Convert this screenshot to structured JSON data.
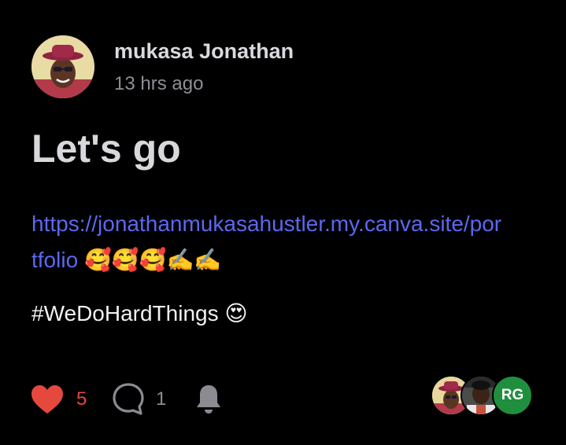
{
  "post": {
    "author_name": "mukasa Jonathan",
    "timestamp": "13 hrs ago",
    "title": "Let's go",
    "link_text": "https://jonathanmukasahustler.my.canva.site/portfolio",
    "link_emojis": "🥰🥰🥰✍️✍️",
    "hashtag_text": "#WeDoHardThings",
    "hashtag_emoji": "😍"
  },
  "reactions": {
    "likes": "5",
    "comments": "1",
    "like_color": "#e5483d",
    "icons": [
      "heart-icon",
      "comment-icon",
      "bell-icon"
    ]
  },
  "participants": {
    "initials": "RG",
    "initials_color": "#1f8f3e"
  },
  "colors": {
    "background": "#000000",
    "link": "#5b68f0",
    "muted": "#8e8e95"
  }
}
